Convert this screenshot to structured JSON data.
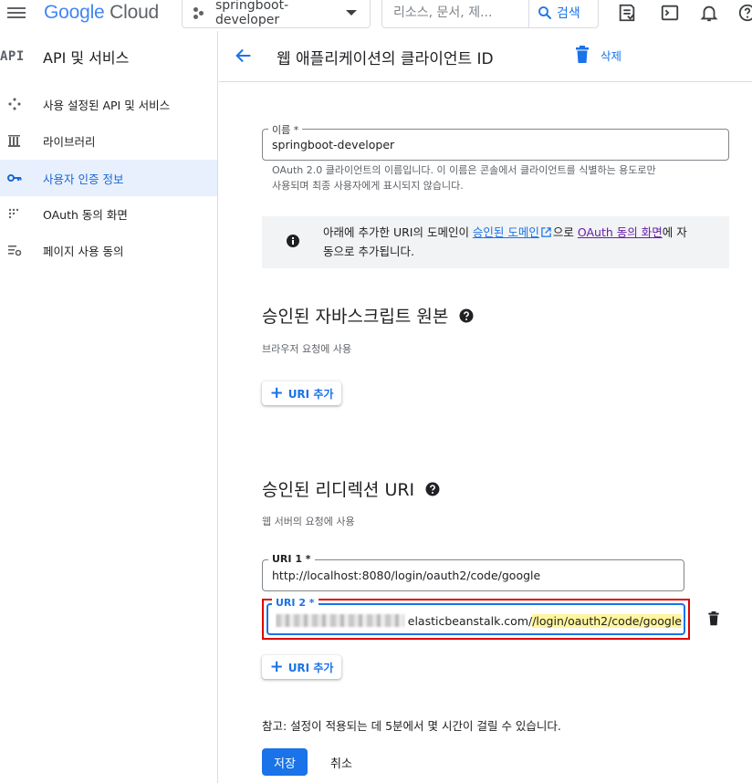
{
  "topbar": {
    "logo_google": "Google",
    "logo_cloud": "Cloud",
    "project_name": "springboot-developer",
    "search_placeholder": "리소스, 문서, 제...",
    "search_button": "검색",
    "icons": [
      "hamburger-icon",
      "project-dots-icon",
      "dropdown-caret-icon",
      "search-icon",
      "notes-icon",
      "terminal-icon",
      "bell-icon",
      "help-icon"
    ]
  },
  "sidebar": {
    "badge": "API",
    "title": "API 및 서비스",
    "items": [
      {
        "label": "사용 설정된 API 및 서비스",
        "icon": "api-diamond-icon",
        "active": false
      },
      {
        "label": "라이브러리",
        "icon": "library-icon",
        "active": false
      },
      {
        "label": "사용자 인증 정보",
        "icon": "key-icon",
        "active": true
      },
      {
        "label": "OAuth 동의 화면",
        "icon": "oauth-dots-icon",
        "active": false
      },
      {
        "label": "페이지 사용 동의",
        "icon": "settings-list-icon",
        "active": false
      }
    ]
  },
  "main": {
    "title": "웹 애플리케이션의 클라이언트 ID",
    "delete_label": "삭제",
    "name_field": {
      "label": "이름 *",
      "value": "springboot-developer",
      "hint_line1": "OAuth 2.0 클라이언트의 이름입니다. 이 이름은 콘솔에서 클라이언트를 식별하는 용도로만",
      "hint_line2": "사용되며 최종 사용자에게 표시되지 않습니다."
    },
    "info": {
      "text_a": "아래에 추가한 URI의 도메인이 ",
      "link1": "승인된 도메인",
      "text_b": "으로 ",
      "link2": "OAuth 동의 화면",
      "text_c": "에 자",
      "text_d": "동으로 추가됩니다."
    },
    "js_origins": {
      "title": "승인된 자바스크립트 원본",
      "subtitle": "브라우저 요청에 사용",
      "add_button": "URI 추가"
    },
    "redirect_uris": {
      "title": "승인된 리디렉션 URI",
      "subtitle": "웹 서버의 요청에 사용",
      "uri1_label": "URI 1 *",
      "uri1_value": "http://localhost:8080/login/oauth2/code/google",
      "uri2_label": "URI 2 *",
      "uri2_domain": "elasticbeanstalk.com/",
      "uri2_path": "/login/oauth2/code/google",
      "add_button": "URI 추가"
    },
    "note": "참고: 설정이 적용되는 데 5분에서 몇 시간이 걸릴 수 있습니다.",
    "save_label": "저장",
    "cancel_label": "취소"
  },
  "colors": {
    "accent": "#1a73e8",
    "active_nav_bg": "#e8f0fe",
    "highlight_box": "#e00000",
    "text_highlight": "#fff59d"
  }
}
